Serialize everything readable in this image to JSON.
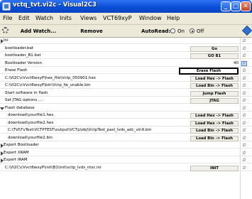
{
  "window": {
    "title": "vctq_tvt.vi2c  -  Visual2C3",
    "min_symbol": "_",
    "max_symbol": "□",
    "close_symbol": "✕"
  },
  "menu": [
    "File",
    "Edit",
    "Watch",
    "Inits",
    "Views",
    "VCT69xyP",
    "Window",
    "Help"
  ],
  "toolbar": {
    "add_watch": "Add Watch...",
    "remove": "Remove",
    "autoread_label": "AutoRead:",
    "on_label": "On",
    "off_label": "Off",
    "autoread_value": "Off"
  },
  "rows": [
    {
      "label": "Ini",
      "kind": "tree-collapsed",
      "indicator": "∅"
    },
    {
      "label": "bootloader.bat",
      "action": "Go",
      "indicator": "∅"
    },
    {
      "label": "bootloader_B1.bat",
      "action": "GO B1",
      "indicator": "∅"
    },
    {
      "label": "Bootloader Version",
      "value": "40",
      "indicator": "☒",
      "indicator_type": "check"
    },
    {
      "label": "Erase Flash",
      "action": "Erase Flash",
      "selected": true,
      "indicator": "∅"
    },
    {
      "label": "C:\\VI2C\\cVvct6wxyP\\hex_file\\Vctp_050901.hex",
      "action": "Load Hex -> Flash",
      "indicator": "∅"
    },
    {
      "label": "C:\\VI2C\\cVvct6wxyP\\bin\\Vctp_fw_unable.bin",
      "action": "Load Bin -> Flash",
      "indicator": "∅"
    },
    {
      "label": "Start software in flash",
      "action": "Jump Flash",
      "indicator": "∅"
    },
    {
      "label": "Set JTAG options ...",
      "action": "JTAG",
      "indicator": "∅"
    },
    {
      "label": "Flash database",
      "kind": "tree-expanded",
      "indicator": "∅"
    },
    {
      "label": "download\\yourfile1.hex",
      "kind": "child",
      "action": "Load Hex -> Flash",
      "indicator": "∅"
    },
    {
      "label": "download\\yourfile2.hex",
      "kind": "child",
      "action": "Load Hex -> Flash",
      "indicator": "∅"
    },
    {
      "label": "C:\\TVI\\TvTest\\VCTPTEST\\output\\VCTp\\obj\\VctpTest_pasl_lvds_adc_vin9.bin",
      "kind": "child",
      "action": "Load Bin -> Flash",
      "indicator": "∅"
    },
    {
      "label": "download\\yourfile2.bin",
      "kind": "child",
      "action": "Load Bin -> Flash",
      "indicator": "∅"
    },
    {
      "label": "Expert Bootloader",
      "kind": "tree-collapsed",
      "indicator": "∅"
    },
    {
      "label": "Expert XRAM",
      "kind": "tree-collapsed",
      "indicator": "∅"
    },
    {
      "label": "Expert IRAM",
      "kind": "tree-collapsed",
      "indicator": "∅"
    },
    {
      "label": "C:\\VI2C\\cVvct6wxyP\\init\\B1\\init\\vctp_lvds_ntsc.ini",
      "action": "INIT",
      "indicator": "∅"
    }
  ],
  "colors": {
    "titlebar": "#0a4fd8",
    "menubar": "#ece9d8",
    "selected_border": "#000000"
  },
  "icons": {
    "toolbar_left": "gear-icon",
    "toolbar_right": "diamond-icon"
  }
}
